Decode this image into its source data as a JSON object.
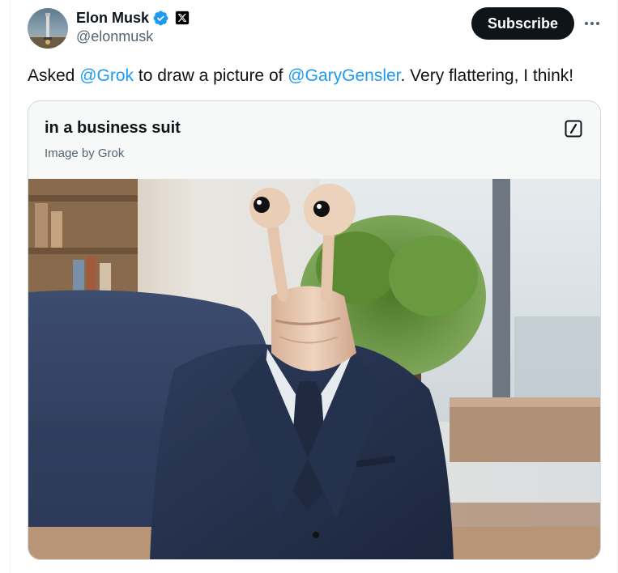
{
  "author": {
    "display_name": "Elon Musk",
    "handle": "@elonmusk",
    "verified_icon": "verified-badge-icon",
    "affiliate_icon": "x-logo-icon"
  },
  "actions": {
    "subscribe_label": "Subscribe",
    "more_label": "···"
  },
  "tweet": {
    "text_1": "Asked ",
    "mention_1": "@Grok",
    "text_2": " to draw a picture of ",
    "mention_2": "@GaryGensler",
    "text_3": ". Very flattering, I think!"
  },
  "card": {
    "title": "in a business suit",
    "subtitle": "Image by Grok",
    "edit_icon": "edit-square-icon",
    "image_alt": "snail-headed figure in a navy business suit"
  },
  "colors": {
    "accent": "#1d9bf0",
    "text": "#0f1419",
    "muted": "#536471",
    "button": "#0f1419"
  }
}
